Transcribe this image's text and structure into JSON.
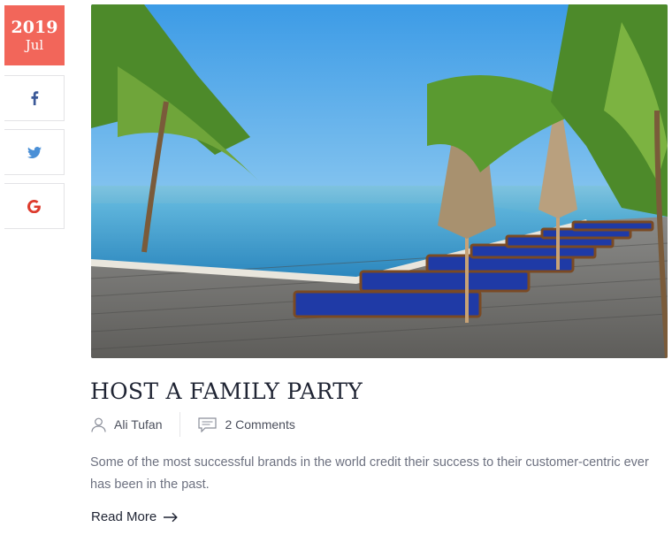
{
  "post": {
    "date": {
      "year": "2019",
      "month": "Jul"
    },
    "title": "HOST A FAMILY PARTY",
    "author": "Ali Tufan",
    "comments": "2 Comments",
    "excerpt": "Some of the most successful brands in the world credit their success to their customer-centric ever has been in the past.",
    "read_more": "Read More"
  },
  "share": [
    {
      "network": "facebook",
      "icon": "facebook-icon",
      "color": "#3b5998"
    },
    {
      "network": "twitter",
      "icon": "twitter-icon",
      "color": "#4a8fd6"
    },
    {
      "network": "google",
      "icon": "google-icon",
      "color": "#dd3b2d"
    }
  ],
  "colors": {
    "accent": "#f2665a",
    "title": "#1f2433",
    "text": "#6d7180"
  }
}
